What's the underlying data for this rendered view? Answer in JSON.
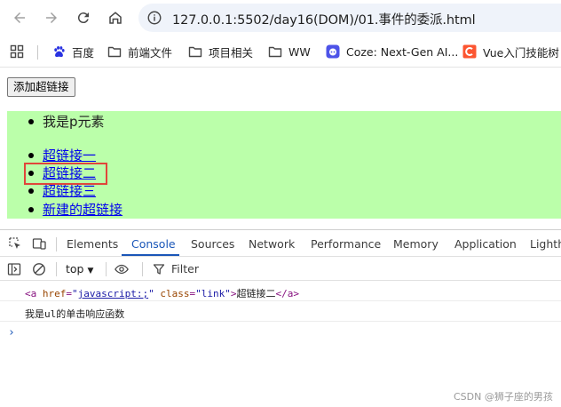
{
  "browser": {
    "url": "127.0.0.1:5502/day16(DOM)/01.事件的委派.html",
    "bookmarks": [
      {
        "label": "百度",
        "icon": "baidu-paw-icon"
      },
      {
        "label": "前端文件",
        "icon": "folder-icon"
      },
      {
        "label": "项目相关",
        "icon": "folder-icon"
      },
      {
        "label": "WW",
        "icon": "folder-icon"
      },
      {
        "label": "Coze: Next-Gen AI...",
        "icon": "coze-icon"
      },
      {
        "label": "Vue入门技能树",
        "icon": "csdn-c-icon"
      }
    ]
  },
  "page": {
    "add_button_label": "添加超链接",
    "p_item": "我是p元素",
    "links": [
      "超链接一",
      "超链接二",
      "超链接三",
      "新建的超链接"
    ],
    "colors": {
      "list_background": "#bbffaa",
      "link": "#0000ee",
      "highlight": "#e0463a"
    }
  },
  "devtools": {
    "tabs": [
      "Elements",
      "Console",
      "Sources",
      "Network",
      "Performance",
      "Memory",
      "Application",
      "Lighth"
    ],
    "active_tab": "Console",
    "context": "top",
    "filter_placeholder": "Filter",
    "console_logs": {
      "element": {
        "tag_open": "<a",
        "attr_href": "href",
        "href_value": "javascript:;",
        "attr_class": "class",
        "class_value": "link",
        "text": "超链接二",
        "tag_close": "</a>"
      },
      "message": "我是ul的单击响应函数"
    },
    "prompt": "›"
  },
  "watermark": "CSDN @狮子座的男孩"
}
